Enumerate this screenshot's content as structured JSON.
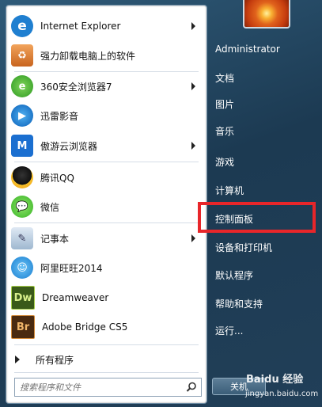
{
  "left_panel": {
    "pinned": [
      {
        "label": "Internet Explorer",
        "icon": "internet-explorer-icon",
        "has_submenu": true
      },
      {
        "label": "强力卸载电脑上的软件",
        "icon": "uninstaller-icon",
        "has_submenu": false
      }
    ],
    "recent": [
      {
        "label": "360安全浏览器7",
        "icon": "360-browser-icon",
        "has_submenu": true
      },
      {
        "label": "迅雷影音",
        "icon": "xunlei-player-icon",
        "has_submenu": false
      },
      {
        "label": "傲游云浏览器",
        "icon": "maxthon-icon",
        "has_submenu": true
      },
      {
        "label": "腾讯QQ",
        "icon": "qq-icon",
        "has_submenu": false
      },
      {
        "label": "微信",
        "icon": "wechat-icon",
        "has_submenu": false
      },
      {
        "label": "记事本",
        "icon": "notepad-icon",
        "has_submenu": true
      },
      {
        "label": "阿里旺旺2014",
        "icon": "aliwangwang-icon",
        "has_submenu": false
      },
      {
        "label": "Dreamweaver",
        "icon": "dreamweaver-icon",
        "has_submenu": false,
        "icon_text": "Dw"
      },
      {
        "label": "Adobe Bridge CS5",
        "icon": "adobe-bridge-icon",
        "has_submenu": false,
        "icon_text": "Br"
      }
    ],
    "all_programs_label": "所有程序",
    "search_placeholder": "搜索程序和文件"
  },
  "right_panel": {
    "user_name": "Administrator",
    "items": [
      "文档",
      "图片",
      "音乐",
      "游戏",
      "计算机",
      "控制面板",
      "设备和打印机",
      "默认程序",
      "帮助和支持",
      "运行..."
    ],
    "highlighted_item": "控制面板",
    "shutdown_label": "关机"
  },
  "watermark": {
    "text": "Baidu 经验",
    "url": "jingyan.baidu.com"
  },
  "colors": {
    "highlight_box": "#e8262a",
    "panel_bg": "#ffffff",
    "right_bg": "#2a4f6c"
  }
}
